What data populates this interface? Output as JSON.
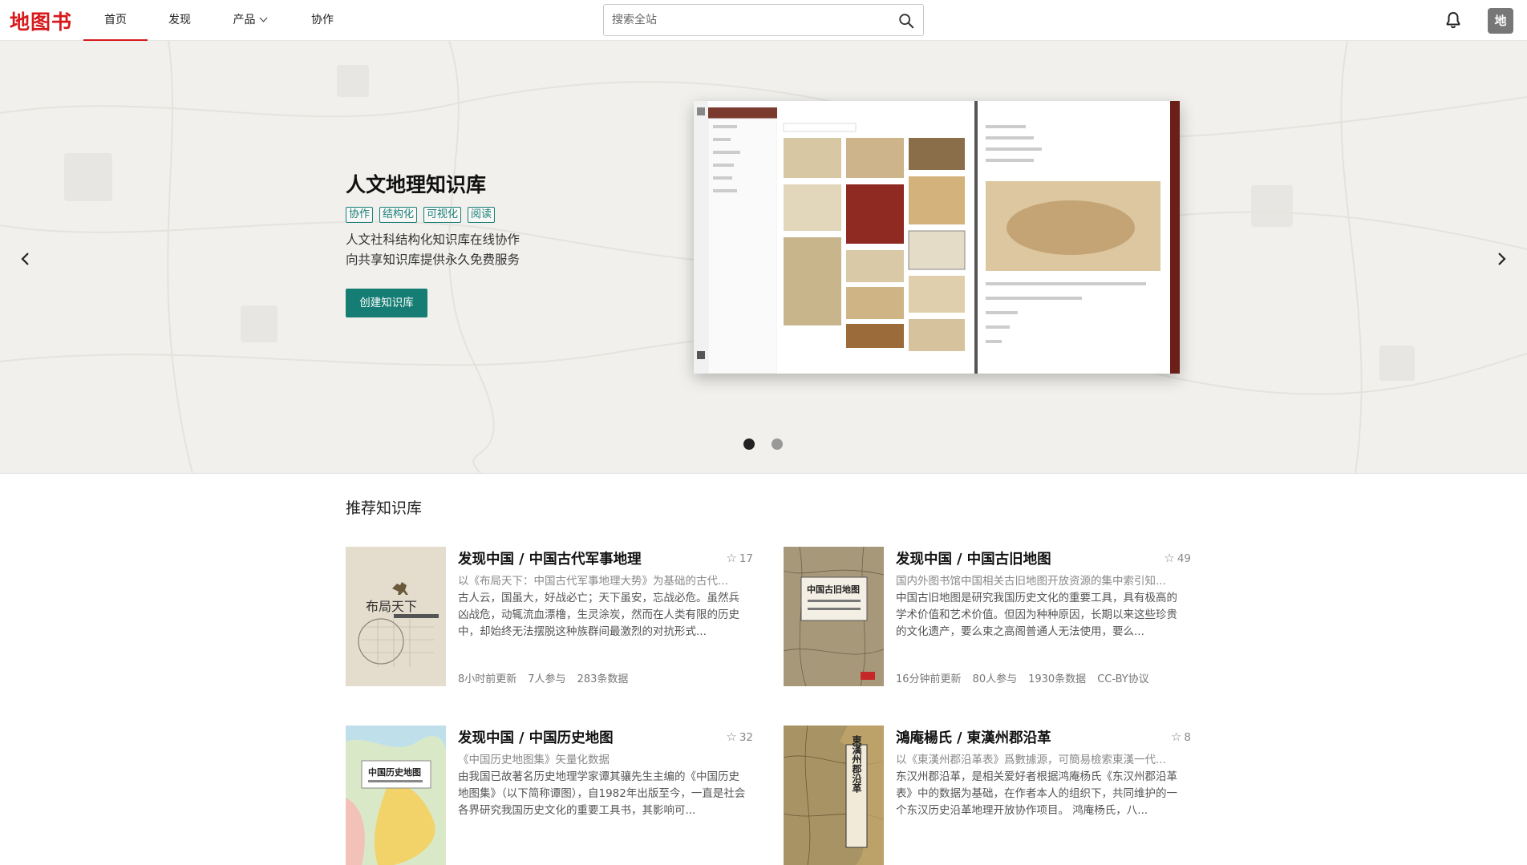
{
  "nav": {
    "logo": "地图书",
    "items": [
      {
        "label": "首页"
      },
      {
        "label": "发现"
      },
      {
        "label": "产品"
      },
      {
        "label": "协作"
      }
    ],
    "search_placeholder": "搜索全站",
    "avatar_initial": "地"
  },
  "hero": {
    "title": "人文地理知识库",
    "tags": [
      "协作",
      "结构化",
      "可视化",
      "阅读"
    ],
    "desc_line1": "人文社科结构化知识库在线协作",
    "desc_line2": "向共享知识库提供永久免费服务",
    "cta": "创建知识库",
    "slide_count": 2,
    "active_slide": 1
  },
  "recommended": {
    "title": "推荐知识库",
    "cards": [
      {
        "title": "发现中国 / 中国古代军事地理",
        "stars": "17",
        "subtitle": "以《布局天下：中国古代军事地理大势》为基础的古代...",
        "desc": "古人云，国虽大，好战必亡；天下虽安，忘战必危。虽然兵凶战危，动辄流血漂橹，生灵涂炭，然而在人类有限的历史中，却始终无法摆脱这种族群间最激烈的对抗形式...",
        "meta": [
          "8小时前更新",
          "7人参与",
          "283条数据"
        ],
        "cover_text": "布局天下"
      },
      {
        "title": "发现中国 / 中国古旧地图",
        "stars": "49",
        "subtitle": "国内外图书馆中国相关古旧地图开放资源的集中索引知...",
        "desc": "中国古旧地图是研究我国历史文化的重要工具，具有极高的学术价值和艺术价值。但因为种种原因，长期以来这些珍贵的文化遗产，要么束之高阁普通人无法使用，要么...",
        "meta": [
          "16分钟前更新",
          "80人参与",
          "1930条数据",
          "CC-BY协议"
        ],
        "cover_text": "中国古旧地图"
      },
      {
        "title": "发现中国 / 中国历史地图",
        "stars": "32",
        "subtitle": "《中国历史地图集》矢量化数据",
        "desc": "由我国已故著名历史地理学家谭其骧先生主编的《中国历史地图集》（以下简称谭图），自1982年出版至今，一直是社会各界研究我国历史文化的重要工具书，其影响可...",
        "meta": [],
        "cover_text": "中国历史地图"
      },
      {
        "title": "鴻庵楊氏 / 東漢州郡沿革",
        "stars": "8",
        "subtitle": "以《東漢州郡沿革表》爲數據源，可簡易檢索東漢一代...",
        "desc": "东汉州郡沿革，是相关爱好者根据鸿庵杨氏《东汉州郡沿革表》中的数据为基础，在作者本人的组织下，共同维护的一个东汉历史沿革地理开放协作项目。 鸿庵杨氏，八...",
        "meta": [],
        "cover_text": "東漢州郡沿革"
      }
    ]
  },
  "colors": {
    "brand_red": "#d7191c",
    "accent_teal": "#157d73"
  }
}
